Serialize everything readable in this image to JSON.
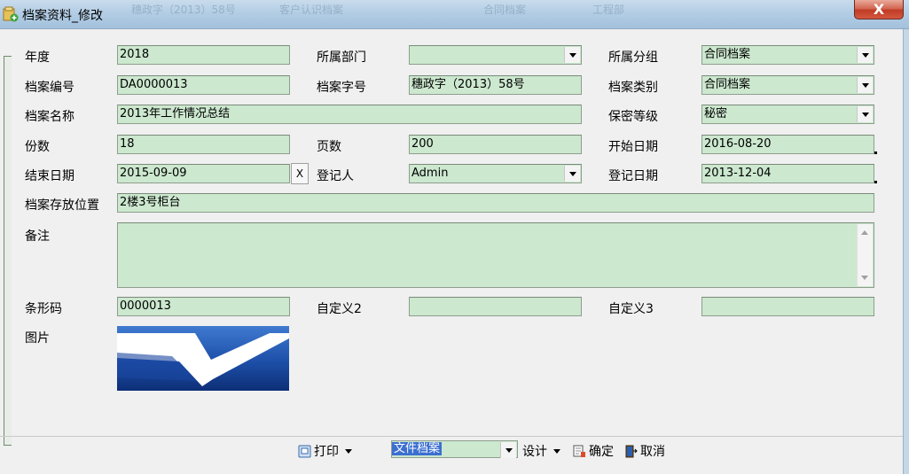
{
  "window": {
    "title": "档案资料_修改",
    "close_label": "X",
    "background_ghost": [
      "穗政字（2013）58号",
      "客户认识档案",
      "合同档案",
      "工程部"
    ]
  },
  "form": {
    "year": {
      "label": "年度",
      "value": "2018"
    },
    "department": {
      "label": "所属部门",
      "value": ""
    },
    "group": {
      "label": "所属分组",
      "value": "合同档案"
    },
    "archive_no": {
      "label": "档案编号",
      "value": "DA0000013"
    },
    "archive_code": {
      "label": "档案字号",
      "value": "穗政字（2013）58号"
    },
    "category": {
      "label": "档案类别",
      "value": "合同档案"
    },
    "archive_name": {
      "label": "档案名称",
      "value": "2013年工作情况总结"
    },
    "secrecy": {
      "label": "保密等级",
      "value": "秘密"
    },
    "copies": {
      "label": "份数",
      "value": "18"
    },
    "pages": {
      "label": "页数",
      "value": "200"
    },
    "start_date": {
      "label": "开始日期",
      "value": "2016-08-20"
    },
    "end_date": {
      "label": "结束日期",
      "value": "2015-09-09",
      "clear_label": "X"
    },
    "registrant": {
      "label": "登记人",
      "value": "Admin"
    },
    "register_date": {
      "label": "登记日期",
      "value": "2013-12-04"
    },
    "location": {
      "label": "档案存放位置",
      "value": "2楼3号柜台"
    },
    "remarks": {
      "label": "备注",
      "value": ""
    },
    "barcode": {
      "label": "条形码",
      "value": "0000013"
    },
    "custom2": {
      "label": "自定义2",
      "value": ""
    },
    "custom3": {
      "label": "自定义3",
      "value": ""
    },
    "image": {
      "label": "图片"
    }
  },
  "toolbar": {
    "print": "打印",
    "template": "文件档案",
    "design": "设计",
    "confirm": "确定",
    "cancel": "取消"
  },
  "colors": {
    "field_bg": "#cce8cf",
    "titlebar": "#b3cde4",
    "close_button": "#c13b25",
    "logo_blue": "#1b3f8e"
  }
}
